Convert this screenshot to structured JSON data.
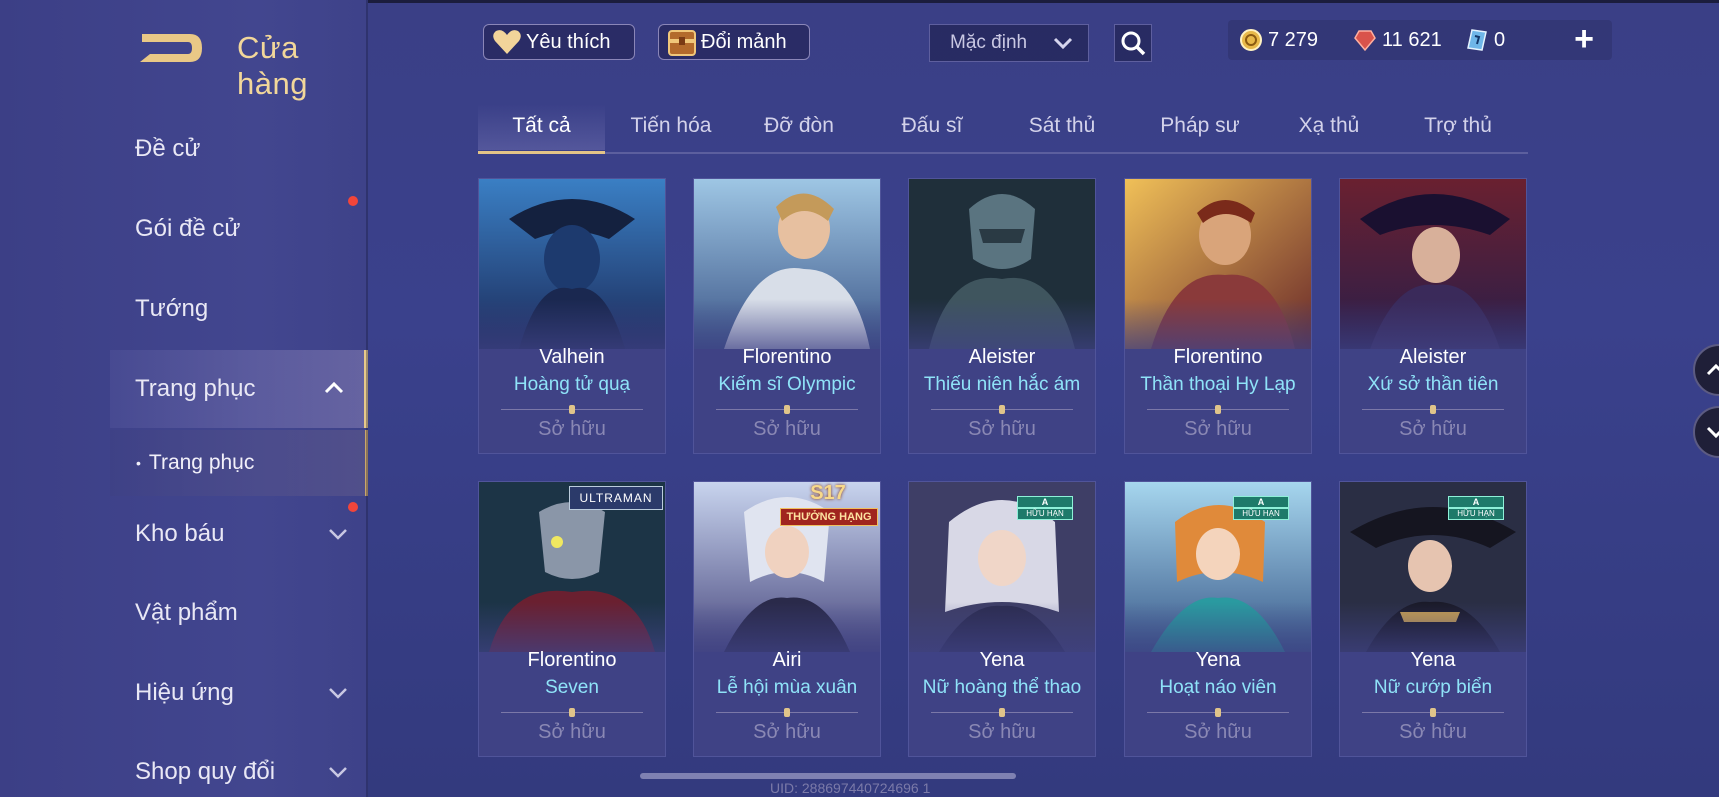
{
  "header": {
    "title": "Cửa hàng",
    "favorites_label": "Yêu thích",
    "exchange_label": "Đổi mảnh",
    "sort_value": "Mặc định",
    "currencies": [
      {
        "icon": "gold-coin-icon",
        "value": "7 279"
      },
      {
        "icon": "red-gem-icon",
        "value": "11 621"
      },
      {
        "icon": "voucher-icon",
        "value": "0"
      }
    ],
    "plus_label": "+"
  },
  "sidebar": {
    "items": [
      {
        "label": "Đề cử"
      },
      {
        "label": "Gói đề cử"
      },
      {
        "label": "Tướng"
      },
      {
        "label": "Trang phục"
      },
      {
        "label": "Kho báu"
      },
      {
        "label": "Vật phẩm"
      },
      {
        "label": "Hiệu ứng"
      },
      {
        "label": "Shop quy đổi"
      }
    ],
    "sub_item": {
      "bullet": "•",
      "label": "Trang phục"
    }
  },
  "tabs": [
    "Tất cả",
    "Tiến hóa",
    "Đỡ đòn",
    "Đấu sĩ",
    "Sát thủ",
    "Pháp sư",
    "Xạ thủ",
    "Trợ thủ"
  ],
  "cards": [
    {
      "hero": "Valhein",
      "skin": "Hoàng tử quạ",
      "status": "Sở hữu"
    },
    {
      "hero": "Florentino",
      "skin": "Kiếm sĩ Olympic",
      "status": "Sở hữu"
    },
    {
      "hero": "Aleister",
      "skin": "Thiếu niên hắc ám",
      "status": "Sở hữu"
    },
    {
      "hero": "Florentino",
      "skin": "Thần thoại Hy Lạp",
      "status": "Sở hữu"
    },
    {
      "hero": "Aleister",
      "skin": "Xứ sở thần tiên",
      "status": "Sở hữu"
    },
    {
      "hero": "Florentino",
      "skin": "Seven",
      "status": "Sở hữu",
      "badge": "ULTRAMAN"
    },
    {
      "hero": "Airi",
      "skin": "Lễ hội mùa xuân",
      "status": "Sở hữu",
      "badge": "S17",
      "badge_sub": "THƯỞNG HẠNG"
    },
    {
      "hero": "Yena",
      "skin": "Nữ hoàng thể thao",
      "status": "Sở hữu",
      "badge": "A",
      "badge_sub": "HỮU HẠN"
    },
    {
      "hero": "Yena",
      "skin": "Hoạt náo viên",
      "status": "Sở hữu",
      "badge": "A",
      "badge_sub": "HỮU HẠN"
    },
    {
      "hero": "Yena",
      "skin": "Nữ cướp biển",
      "status": "Sở hữu",
      "badge": "A",
      "badge_sub": "HỮU HẠN"
    }
  ],
  "footer": {
    "uid": "UID: 288697440724696 1"
  },
  "colors": {
    "accent_gold": "#e3c487",
    "skin_name": "#8fe3f8",
    "notify_red": "#f2453a"
  }
}
